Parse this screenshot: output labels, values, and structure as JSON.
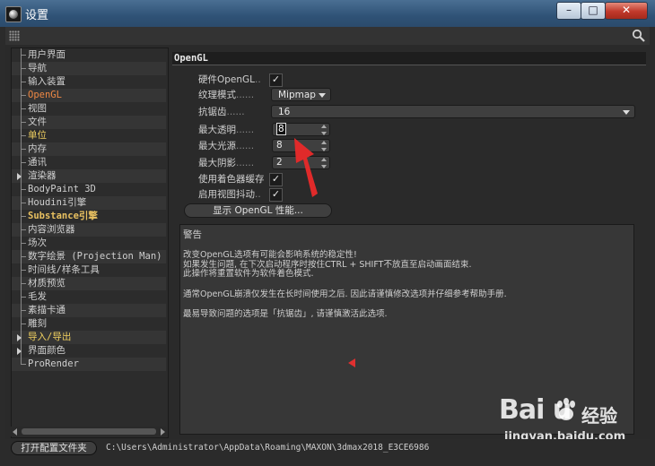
{
  "window": {
    "title": "设置",
    "minimize": "–",
    "maximize": "□",
    "close": "✕"
  },
  "sidebar": {
    "items": [
      {
        "label": "用户界面",
        "style": "normal"
      },
      {
        "label": "导航",
        "style": "normal"
      },
      {
        "label": "输入装置",
        "style": "normal"
      },
      {
        "label": "OpenGL",
        "style": "selected"
      },
      {
        "label": "视图",
        "style": "normal"
      },
      {
        "label": "文件",
        "style": "normal"
      },
      {
        "label": "单位",
        "style": "highlight"
      },
      {
        "label": "内存",
        "style": "normal"
      },
      {
        "label": "通讯",
        "style": "normal"
      },
      {
        "label": "渲染器",
        "style": "normal",
        "expandable": true
      },
      {
        "label": "BodyPaint 3D",
        "style": "normal"
      },
      {
        "label": "Houdini引擎",
        "style": "normal"
      },
      {
        "label": "Substance引擎",
        "style": "bold"
      },
      {
        "label": "内容浏览器",
        "style": "normal"
      },
      {
        "label": "场次",
        "style": "normal"
      },
      {
        "label": "数字绘景 (Projection Man)",
        "style": "normal"
      },
      {
        "label": "时间线/样条工具",
        "style": "normal"
      },
      {
        "label": "材质预览",
        "style": "normal"
      },
      {
        "label": "毛发",
        "style": "normal"
      },
      {
        "label": "素描卡通",
        "style": "normal"
      },
      {
        "label": "雕刻",
        "style": "normal"
      },
      {
        "label": "导入/导出",
        "style": "highlight",
        "expandable": true
      },
      {
        "label": "界面颜色",
        "style": "normal",
        "expandable": true
      },
      {
        "label": "ProRender",
        "style": "normal"
      }
    ]
  },
  "opengl": {
    "section_title": "OpenGL",
    "hardware_label": "硬件OpenGL",
    "hardware_checked": "✓",
    "texture_label": "纹理模式",
    "texture_value": "Mipmap",
    "antialias_label": "抗锯齿",
    "antialias_value": "16",
    "max_transparency_label": "最大透明",
    "max_transparency_value": "8",
    "max_lights_label": "最大光源",
    "max_lights_value": "8",
    "max_shadows_label": "最大阴影",
    "max_shadows_value": "2",
    "shader_cache_label": "使用着色器缓存",
    "shader_cache_checked": "✓",
    "jitter_label": "启用视图抖动",
    "jitter_checked": "✓",
    "performance_button": "显示 OpenGL 性能...",
    "dots_short": "......",
    "dots_mid": ".....",
    "dots_tiny": ".."
  },
  "warning": {
    "title": "警告",
    "line1": "改变OpenGL选项有可能会影响系统的稳定性!",
    "line2": "如果发生问题, 在下次启动程序时按住CTRL + SHIFT不放直至启动画面结束.",
    "line3": "此操作将重置软件为软件着色模式.",
    "line4": "通常OpenGL崩溃仅发生在长时间使用之后. 因此请谨慎修改选项并仔细参考帮助手册.",
    "line5": "最易导致问题的选项是「抗锯齿」, 请谨慎激活此选项."
  },
  "footer": {
    "open_folder_button": "打开配置文件夹",
    "path": "C:\\Users\\Administrator\\AppData\\Roaming\\MAXON\\3dmax2018_E3CE6986"
  },
  "watermark": {
    "logo": "Bai  u",
    "brand": "经验",
    "url": "jingyan.baidu.com"
  },
  "colors": {
    "accent_selected": "#ee8844",
    "highlight": "#f0d060",
    "annotation": "#e03030"
  }
}
